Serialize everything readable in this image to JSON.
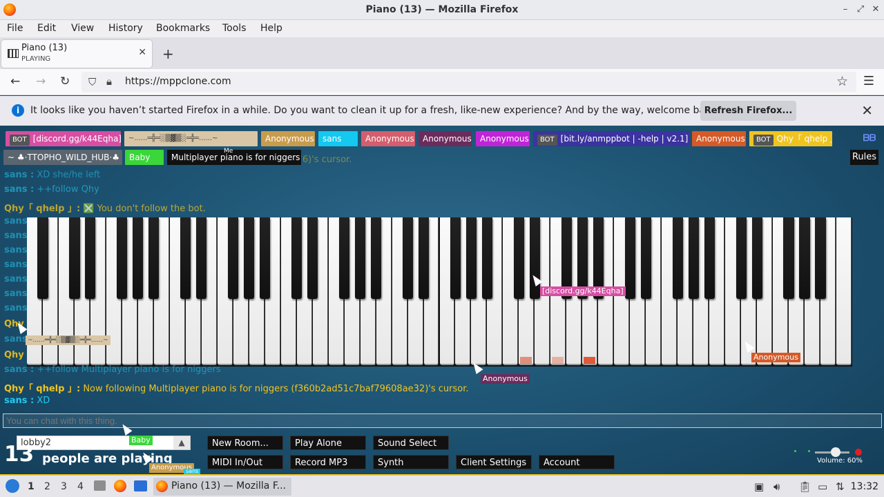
{
  "window": {
    "title": "Piano (13) — Mozilla Firefox"
  },
  "menubar": {
    "items": [
      "File",
      "Edit",
      "View",
      "History",
      "Bookmarks",
      "Tools",
      "Help"
    ]
  },
  "tab": {
    "title": "Piano (13)",
    "subtitle": "PLAYING"
  },
  "nav": {
    "url": "https://mppclone.com"
  },
  "notification": {
    "message": "It looks like you haven’t started Firefox in a while. Do you want to clean it up for a fresh, like-new experience? And by the way, welcome back!",
    "button": "Refresh Firefox..."
  },
  "players": [
    {
      "bot": "BOT",
      "name": "[discord.gg/k44Eqha]",
      "color": "#d64fa3"
    },
    {
      "bot": "",
      "name": "~......═╬═░▒▓▒░═╬═......~",
      "color": "#d8c6a6"
    },
    {
      "bot": "",
      "name": "Anonymous",
      "color": "#c89c4d"
    },
    {
      "bot": "",
      "name": "sans",
      "color": "#14c8ef"
    },
    {
      "bot": "",
      "name": "Anonymous",
      "color": "#d45e6d"
    },
    {
      "bot": "",
      "name": "Anonymous",
      "color": "#6b2c5c"
    },
    {
      "bot": "",
      "name": "Anonymous",
      "color": "#c024d8"
    },
    {
      "bot": "BOT",
      "name": "[bit.ly/anmppbot | -help | v2.1]",
      "color": "#3b33a0"
    },
    {
      "bot": "",
      "name": "Anonymous",
      "color": "#d45a28"
    },
    {
      "bot": "BOT",
      "name": "Qhy「 qhelp 」",
      "color": "#f0c420"
    },
    {
      "bot": "",
      "name": "~ ♣·TTOPHO_WILD_HUB·♣ ~",
      "color": "#5a6570"
    },
    {
      "bot": "",
      "name": "Baby",
      "color": "#3ad63a"
    },
    {
      "bot": "",
      "name": "Multiplayer piano is for niggers",
      "color": "#111111"
    }
  ],
  "me_label": "Me",
  "rules_button": "Rules",
  "chat": [
    {
      "who": "sans :",
      "text": "XD she/he left",
      "who_color": "#24c8ef",
      "text_color": "#24c8ef"
    },
    {
      "who": "sans :",
      "text": "++follow Qhy",
      "who_color": "#24c8ef",
      "text_color": "#24c8ef"
    },
    {
      "who": "Qhy「 qhelp 」:",
      "text": "❎ You don't follow the bot.",
      "who_color": "#f0c420",
      "text_color": "#f0c420"
    },
    {
      "who": "sans :",
      "text": "++follow Multiplayer piano is for niggers",
      "who_color": "#24c8ef",
      "text_color": "#24c8ef"
    },
    {
      "who": "Qhy「 qhelp 」:",
      "text": "Now following Multiplayer piano is for niggers (f360b2ad51c7baf79608ae32)'s cursor.",
      "who_color": "#f0c420",
      "text_color": "#f0c420"
    },
    {
      "who": "sans :",
      "text": "XD",
      "who_color": "#24c8ef",
      "text_color": "#24c8ef"
    }
  ],
  "chat_faded_top": "(9b76)'s cursor.",
  "side_names": {
    "sans": "sans",
    "qhy": "Qhy"
  },
  "cursors": [
    {
      "label": "[discord.gg/k44Eqha]",
      "color": "#d64fa3"
    },
    {
      "label": "Anonymous",
      "color": "#d45a28"
    },
    {
      "label": "Anonymous",
      "color": "#6b2c5c"
    },
    {
      "label": "~......═╬═░▒▓▒░═╬═......~",
      "color": "#d8c6a6"
    },
    {
      "label": "Baby",
      "color": "#3ad63a"
    },
    {
      "label": "Anonymous",
      "color": "#c89c4d"
    },
    {
      "label": "sans",
      "color": "#14c8ef"
    }
  ],
  "chat_input": {
    "placeholder": "You can chat with this thing."
  },
  "room": {
    "name": "lobby2"
  },
  "people": {
    "count": "13",
    "text": "people are playing"
  },
  "controls": {
    "new_room": "New Room...",
    "play_alone": "Play Alone",
    "sound_select": "Sound Select",
    "midi": "MIDI In/Out",
    "record": "Record MP3",
    "synth": "Synth",
    "client_settings": "Client Settings",
    "account": "Account"
  },
  "volume": {
    "label": "Volume: 60%",
    "value": 60
  },
  "taskbar": {
    "workspaces": [
      "1",
      "2",
      "3",
      "4"
    ],
    "active_app": "Piano (13) — Mozilla F...",
    "clock": "13:32"
  }
}
